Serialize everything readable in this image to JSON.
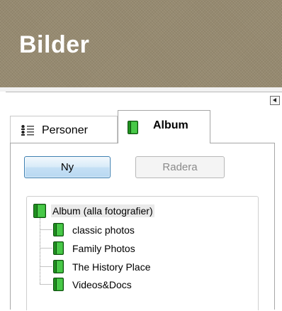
{
  "header": {
    "title": "Bilder"
  },
  "tabs": [
    {
      "label": "Personer",
      "icon": "people-list-icon",
      "active": false
    },
    {
      "label": "Album",
      "icon": "album-book-icon",
      "active": true
    }
  ],
  "buttons": {
    "new_label": "Ny",
    "delete_label": "Radera"
  },
  "tree": {
    "root": {
      "label": "Album (alla fotografier)",
      "icon": "album-book-icon"
    },
    "items": [
      {
        "label": "classic photos",
        "icon": "album-book-icon"
      },
      {
        "label": "Family Photos",
        "icon": "album-book-icon"
      },
      {
        "label": "The History Place",
        "icon": "album-book-icon"
      },
      {
        "label": "Videos&Docs",
        "icon": "album-book-icon"
      }
    ]
  },
  "colors": {
    "header_bg": "#968a70",
    "book_green": "#2fae2f",
    "button_blue_border": "#3c7fb1"
  }
}
